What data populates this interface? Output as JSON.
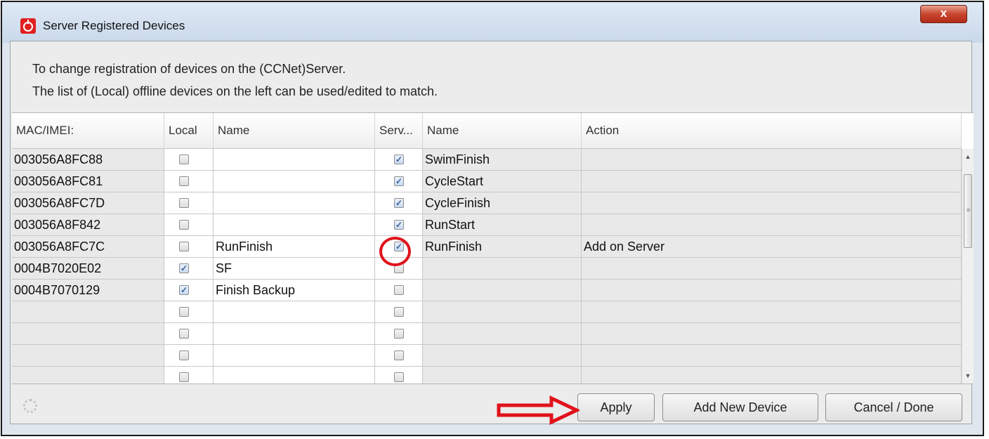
{
  "window": {
    "title": "Server Registered Devices",
    "close_label": "x"
  },
  "description": {
    "line1": "To change registration of devices on the (CCNet)Server.",
    "line2": "The list of (Local) offline devices on the left can be used/edited to match."
  },
  "table": {
    "columns": [
      "MAC/IMEI:",
      "Local",
      "Name",
      "Serv...",
      "Name",
      "Action"
    ],
    "rows": [
      {
        "mac": "003056A8FC88",
        "local": false,
        "local_name": "",
        "server": true,
        "server_name": "SwimFinish",
        "action": ""
      },
      {
        "mac": "003056A8FC81",
        "local": false,
        "local_name": "",
        "server": true,
        "server_name": "CycleStart",
        "action": ""
      },
      {
        "mac": "003056A8FC7D",
        "local": false,
        "local_name": "",
        "server": true,
        "server_name": "CycleFinish",
        "action": ""
      },
      {
        "mac": "003056A8F842",
        "local": false,
        "local_name": "",
        "server": true,
        "server_name": "RunStart",
        "action": ""
      },
      {
        "mac": "003056A8FC7C",
        "local": false,
        "local_name": "RunFinish",
        "server": true,
        "server_name": "RunFinish",
        "action": "Add on Server"
      },
      {
        "mac": "0004B7020E02",
        "local": true,
        "local_name": "SF",
        "server": false,
        "server_name": "",
        "action": ""
      },
      {
        "mac": "0004B7070129",
        "local": true,
        "local_name": "Finish Backup",
        "server": false,
        "server_name": "",
        "action": ""
      },
      {
        "mac": "",
        "local": false,
        "local_name": "",
        "server": false,
        "server_name": "",
        "action": ""
      },
      {
        "mac": "",
        "local": false,
        "local_name": "",
        "server": false,
        "server_name": "",
        "action": ""
      },
      {
        "mac": "",
        "local": false,
        "local_name": "",
        "server": false,
        "server_name": "",
        "action": ""
      },
      {
        "mac": "",
        "local": false,
        "local_name": "",
        "server": false,
        "server_name": "",
        "action": ""
      }
    ]
  },
  "buttons": {
    "apply": "Apply",
    "add_new_device": "Add New Device",
    "cancel_done": "Cancel / Done"
  },
  "icons": {
    "app": "stopwatch-icon",
    "loading": "spinner-icon",
    "annotation_arrow": "red-arrow-icon",
    "annotation_circle": "red-circle-highlight"
  },
  "colors": {
    "annotation_red": "#e0121b",
    "app_icon_red": "#e02020",
    "check_blue": "#3c5f94"
  }
}
